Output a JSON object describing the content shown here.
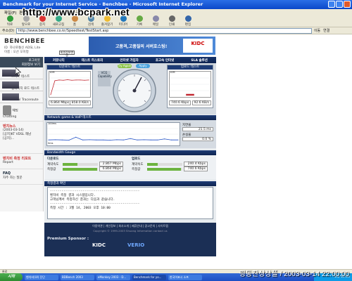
{
  "window": {
    "title": "Benchmark for your Internet Service - Benchbee - Microsoft Internet Explorer"
  },
  "menubar": {
    "items": [
      "파일(F)",
      "편집(E)",
      "보기(V)",
      "즐겨찾기(A)",
      "도구(T)",
      "도움말(H)"
    ]
  },
  "overlay_url": "http://www.bcpark.net",
  "toolbar": {
    "buttons": [
      {
        "label": "뒤로",
        "icon": "back-arrow-icon"
      },
      {
        "label": "앞으로",
        "icon": "forward-arrow-icon"
      },
      {
        "label": "중지",
        "icon": "stop-icon"
      },
      {
        "label": "새로고침",
        "icon": "refresh-icon"
      },
      {
        "label": "홈",
        "icon": "home-icon"
      },
      {
        "label": "검색",
        "icon": "search-icon"
      },
      {
        "label": "즐겨찾기",
        "icon": "favorites-icon"
      },
      {
        "label": "미디어",
        "icon": "media-icon"
      },
      {
        "label": "기록",
        "icon": "history-icon"
      },
      {
        "label": "메일",
        "icon": "mail-icon"
      },
      {
        "label": "인쇄",
        "icon": "print-icon"
      },
      {
        "label": "편집",
        "icon": "edit-icon"
      }
    ]
  },
  "address": {
    "label": "주소(D)",
    "value": "http://www.benchbee.co.kr/Speedtest/TestStart.asp",
    "go_label": "이동",
    "links_label": "연결"
  },
  "site": {
    "logo": "BENCHBEE",
    "subtitle": "ID  하나로통신 ADSL Lite\n이름 : 오산 오이정",
    "logo_button": "회원정보변경",
    "banner_text": "고품격,고품질의 서버호스팅!",
    "banner_logo": "KIDC"
  },
  "sidebar": {
    "login": "로그아웃\n회원정보 보기",
    "items": [
      "스피드 테스트",
      "웹페이지 로드 테스트",
      "Visual Traceroute"
    ],
    "chatting": "채팅\nChatting",
    "notice_head": "벤치뉴스",
    "notice_items": [
      "(2003-03-14)",
      "[공지]KT VDSL 해남",
      "[공지]..."
    ],
    "faq_head": "FAQ",
    "faq_sub": "자주 하는 질문",
    "report_head": "벤치비 측정 리포트",
    "report_sub": "Report"
  },
  "tabs": [
    "커뮤니티",
    "테스트 히스토리",
    "인터넷 가입자",
    "초고속 인터넷",
    "SLA 솔루션"
  ],
  "download": {
    "title": "다운로드 테스트",
    "axis_top": "10M",
    "axis_bottom": "0",
    "readout_mbps": "6.864 Mbps",
    "readout_kbs": "858.0 KB/s"
  },
  "upload": {
    "title": "업로드 테스트",
    "axis_top": "10M",
    "axis_bottom": "0",
    "readout_kbps": "740.6 Kbps",
    "readout_kbs": "92.6 KB/s"
  },
  "gauge": {
    "pill_left": "Try Again",
    "pill_right": "Apply",
    "vcq_label": "VCQ\nCapability"
  },
  "network": {
    "title": "Network game & VoIP 테스트",
    "axis_top": "100ms",
    "axis_bottom": "0ms",
    "latency_label": "지연율",
    "latency_value": "21.5 ms",
    "loss_label": "손실율",
    "loss_value": "0.0 %"
  },
  "bandwidth": {
    "title": "Bandwidth Gauge",
    "download_head": "다운로드",
    "upload_head": "업로드",
    "rows": {
      "download": [
        {
          "label": "계약속도",
          "value": "2.867 Mbps",
          "fill": 0.42
        },
        {
          "label": "측정값",
          "value": "6.864 Mbps",
          "fill": 0.98
        }
      ],
      "upload": [
        {
          "label": "계약속도",
          "value": "240.4 Kbps",
          "fill": 0.3
        },
        {
          "label": "측정값",
          "value": "740.6 Kbps",
          "fill": 0.95
        }
      ]
    }
  },
  "result": {
    "title": "측정결과 확인",
    "lines": [
      "-----------------------------------------------",
      "벤치비 측정 결과 시스템입니다.",
      "고객님께서 측정하신 결과는 다음과 같습니다.",
      "-----------------------------------------------",
      "",
      "측정 시간 :        3월 14, 2003 오후 10:00"
    ]
  },
  "footer": {
    "links": "이용약관  |  개인정보  |  회사소개  |  제휴안내  |  광고문의  |  사이트맵",
    "copyright": "Copyright © 1999-2003 Shuang Information  contact us",
    "sponsor_label": "Premium Sponsor :",
    "sponsor_1": "KIDC",
    "sponsor_2": "VERIO"
  },
  "statusbar": {
    "text": "완료"
  },
  "taskbar": {
    "start": "시작",
    "tasks": [
      "벤치비(UI) 진단",
      "BDBench 2003",
      "eMonkey 2003 - D...",
      "Benchmark for yo...",
      "한국어표시 소프"
    ],
    "active_index": 3,
    "clock": "오후 10:00"
  },
  "timestamp_overlay": "링동찬상상플 / 2003-03-14 22:00:00",
  "colors": {
    "nav_dark": "#0f2450",
    "bar_green": "#6cb33f",
    "titlebar_blue": "#0a47c9",
    "taskbar_blue": "#1c4fc4"
  },
  "chart_data": [
    {
      "type": "line",
      "title": "다운로드 테스트",
      "ylim": [
        0,
        10
      ],
      "ylabel": "Mbps",
      "x": [
        1,
        2,
        3,
        4,
        5,
        6,
        7,
        8,
        9,
        10
      ],
      "series": [
        {
          "values": [
            0.4,
            6.6,
            6.9,
            6.8,
            7.0,
            6.8,
            6.9,
            6.9,
            6.8,
            6.9
          ]
        }
      ]
    },
    {
      "type": "bar",
      "title": "업로드 테스트",
      "ylim": [
        0,
        10
      ],
      "categories": [
        "upload"
      ],
      "values": [
        0.74
      ]
    },
    {
      "type": "line",
      "title": "Network game & VoIP 테스트",
      "ylim": [
        0,
        100
      ],
      "ylabel": "ms",
      "x": [
        1,
        2,
        3,
        4,
        5,
        6,
        7,
        8,
        9,
        10,
        11,
        12,
        13,
        14,
        15,
        16,
        17,
        18,
        19,
        20
      ],
      "series": [
        {
          "values": [
            21,
            22,
            21,
            20,
            35,
            21,
            22,
            21,
            21,
            20,
            22,
            21,
            28,
            21,
            22,
            21,
            21,
            26,
            21,
            21
          ]
        }
      ]
    }
  ]
}
